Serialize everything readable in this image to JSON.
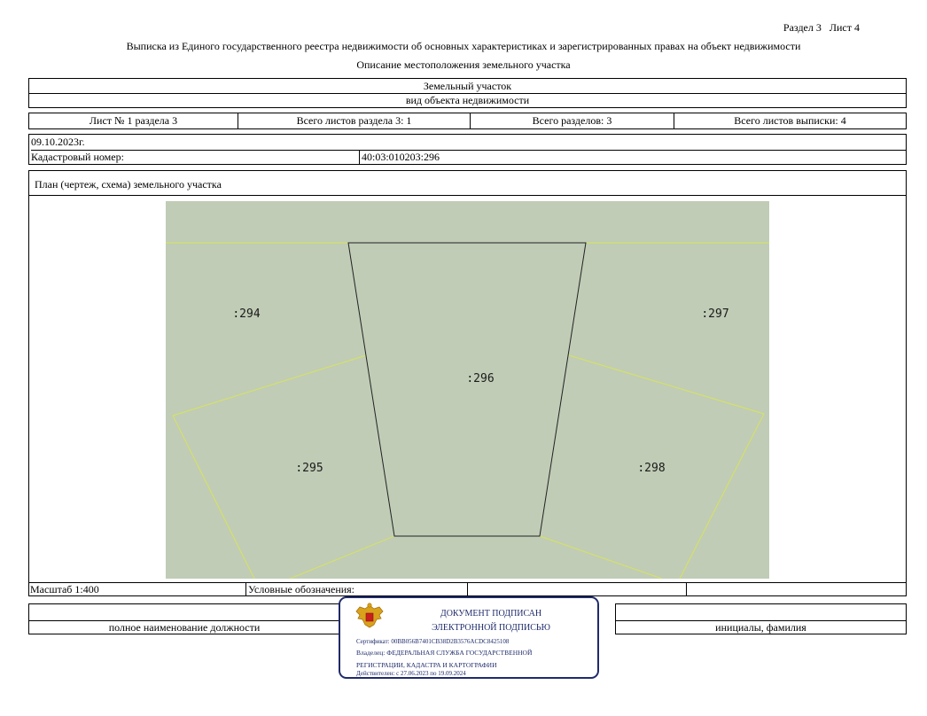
{
  "header": {
    "section_sheet": "Раздел 3   Лист 4",
    "title": "Выписка из Единого государственного реестра недвижимости об основных характеристиках и зарегистрированных правах на объект недвижимости",
    "subtitle": "Описание местоположения земельного участка"
  },
  "object": {
    "type": "Земельный участок",
    "type_caption": "вид объекта недвижимости"
  },
  "sheet_info": {
    "sheet_of_section": "Лист № 1 раздела 3",
    "total_sheets_section": "Всего листов раздела 3: 1",
    "total_sections": "Всего разделов: 3",
    "total_sheets_extract": "Всего листов выписки: 4"
  },
  "date": "09.10.2023г.",
  "cadastral": {
    "label": "Кадастровый номер:",
    "value": "40:03:010203:296"
  },
  "plan": {
    "title": "План (чертеж, схема) земельного участка",
    "labels": {
      "p294": ":294",
      "p295": ":295",
      "p296": ":296",
      "p297": ":297",
      "p298": ":298"
    }
  },
  "footer": {
    "scale": "Масштаб 1:400",
    "legend": "Условные обозначения:",
    "position_caption": "полное наименование должности",
    "name_caption": "инициалы, фамилия"
  },
  "stamp": {
    "line1": "ДОКУМЕНТ ПОДПИСАН",
    "line2": "ЭЛЕКТРОННОЙ ПОДПИСЬЮ",
    "certificate": "Сертификат: 00BB056B7401CB38D2B3576ACDC8425108",
    "owner": "Владелец: ФЕДЕРАЛЬНАЯ СЛУЖБА ГОСУДАРСТВЕННОЙ",
    "owner2": "РЕГИСТРАЦИИ, КАДАСТРА И КАРТОГРАФИИ",
    "validity": "Действителен: с 27.06.2023 по 19.09.2024"
  },
  "colors": {
    "map_fill": "#c0ccb6",
    "boundary_line": "#d4e06a",
    "parcel_border": "#222222",
    "stamp": "#1f2b6b"
  }
}
